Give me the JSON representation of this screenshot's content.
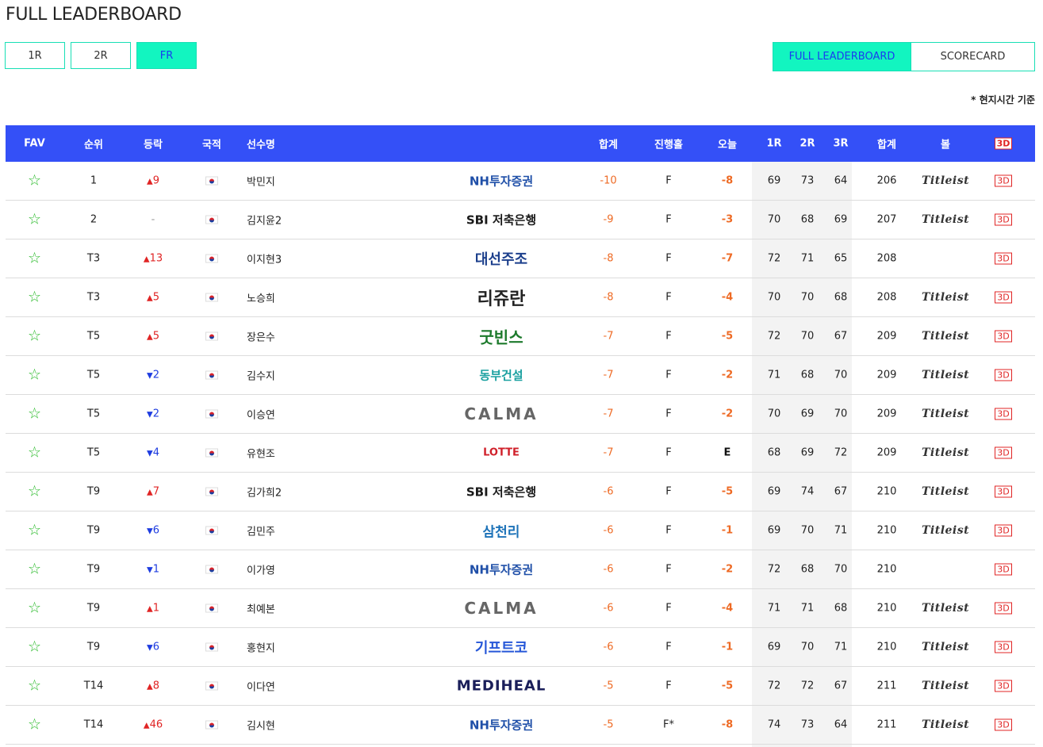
{
  "page_title": "FULL LEADERBOARD",
  "round_tabs": [
    {
      "label": "1R",
      "active": false
    },
    {
      "label": "2R",
      "active": false
    },
    {
      "label": "FR",
      "active": true
    }
  ],
  "view_tabs": [
    {
      "label": "FULL LEADERBOARD",
      "active": true
    },
    {
      "label": "SCORECARD",
      "active": false
    }
  ],
  "note": "* 현지시간 기준",
  "columns": {
    "fav": "FAV",
    "rank": "순위",
    "move": "등락",
    "nat": "국적",
    "name": "선수명",
    "total": "합계",
    "hole": "진행홀",
    "today": "오늘",
    "r1": "1R",
    "r2": "2R",
    "r3": "3R",
    "sum": "합계",
    "ball": "볼",
    "three_d": "3D"
  },
  "colors": {
    "header_bg": "#3450f7",
    "accent": "#12f5c0",
    "up": "#e02424",
    "down": "#1e3ce0",
    "score": "#ee6a24"
  },
  "rows": [
    {
      "rank": "1",
      "dir": "up",
      "move": "9",
      "name": "박민지",
      "sponsor": "NH투자증권",
      "total": "-10",
      "hole": "F",
      "today": "-8",
      "r1": "69",
      "r2": "73",
      "r3": "64",
      "sum": "206",
      "ball": "Titleist",
      "three_d": "3D"
    },
    {
      "rank": "2",
      "dir": "none",
      "move": "-",
      "name": "김지윤2",
      "sponsor": "SBI 저축은행",
      "total": "-9",
      "hole": "F",
      "today": "-3",
      "r1": "70",
      "r2": "68",
      "r3": "69",
      "sum": "207",
      "ball": "Titleist",
      "three_d": "3D"
    },
    {
      "rank": "T3",
      "dir": "up",
      "move": "13",
      "name": "이지현3",
      "sponsor": "대선주조",
      "total": "-8",
      "hole": "F",
      "today": "-7",
      "r1": "72",
      "r2": "71",
      "r3": "65",
      "sum": "208",
      "ball": "",
      "three_d": "3D"
    },
    {
      "rank": "T3",
      "dir": "up",
      "move": "5",
      "name": "노승희",
      "sponsor": "리쥬란",
      "total": "-8",
      "hole": "F",
      "today": "-4",
      "r1": "70",
      "r2": "70",
      "r3": "68",
      "sum": "208",
      "ball": "Titleist",
      "three_d": "3D"
    },
    {
      "rank": "T5",
      "dir": "up",
      "move": "5",
      "name": "장은수",
      "sponsor": "굿빈스",
      "total": "-7",
      "hole": "F",
      "today": "-5",
      "r1": "72",
      "r2": "70",
      "r3": "67",
      "sum": "209",
      "ball": "Titleist",
      "three_d": "3D"
    },
    {
      "rank": "T5",
      "dir": "down",
      "move": "2",
      "name": "김수지",
      "sponsor": "동부건설",
      "total": "-7",
      "hole": "F",
      "today": "-2",
      "r1": "71",
      "r2": "68",
      "r3": "70",
      "sum": "209",
      "ball": "Titleist",
      "three_d": "3D"
    },
    {
      "rank": "T5",
      "dir": "down",
      "move": "2",
      "name": "이승연",
      "sponsor": "CALMA",
      "total": "-7",
      "hole": "F",
      "today": "-2",
      "r1": "70",
      "r2": "69",
      "r3": "70",
      "sum": "209",
      "ball": "Titleist",
      "three_d": "3D"
    },
    {
      "rank": "T5",
      "dir": "down",
      "move": "4",
      "name": "유현조",
      "sponsor": "LOTTE",
      "total": "-7",
      "hole": "F",
      "today": "E",
      "r1": "68",
      "r2": "69",
      "r3": "72",
      "sum": "209",
      "ball": "Titleist",
      "three_d": "3D"
    },
    {
      "rank": "T9",
      "dir": "up",
      "move": "7",
      "name": "김가희2",
      "sponsor": "SBI 저축은행",
      "total": "-6",
      "hole": "F",
      "today": "-5",
      "r1": "69",
      "r2": "74",
      "r3": "67",
      "sum": "210",
      "ball": "Titleist",
      "three_d": "3D"
    },
    {
      "rank": "T9",
      "dir": "down",
      "move": "6",
      "name": "김민주",
      "sponsor": "삼천리",
      "total": "-6",
      "hole": "F",
      "today": "-1",
      "r1": "69",
      "r2": "70",
      "r3": "71",
      "sum": "210",
      "ball": "Titleist",
      "three_d": "3D"
    },
    {
      "rank": "T9",
      "dir": "down",
      "move": "1",
      "name": "이가영",
      "sponsor": "NH투자증권",
      "total": "-6",
      "hole": "F",
      "today": "-2",
      "r1": "72",
      "r2": "68",
      "r3": "70",
      "sum": "210",
      "ball": "",
      "three_d": "3D"
    },
    {
      "rank": "T9",
      "dir": "up",
      "move": "1",
      "name": "최예본",
      "sponsor": "CALMA",
      "total": "-6",
      "hole": "F",
      "today": "-4",
      "r1": "71",
      "r2": "71",
      "r3": "68",
      "sum": "210",
      "ball": "Titleist",
      "three_d": "3D"
    },
    {
      "rank": "T9",
      "dir": "down",
      "move": "6",
      "name": "홍현지",
      "sponsor": "기프트코",
      "total": "-6",
      "hole": "F",
      "today": "-1",
      "r1": "69",
      "r2": "70",
      "r3": "71",
      "sum": "210",
      "ball": "Titleist",
      "three_d": "3D"
    },
    {
      "rank": "T14",
      "dir": "up",
      "move": "8",
      "name": "이다연",
      "sponsor": "MEDIHEAL",
      "total": "-5",
      "hole": "F",
      "today": "-5",
      "r1": "72",
      "r2": "72",
      "r3": "67",
      "sum": "211",
      "ball": "Titleist",
      "three_d": "3D"
    },
    {
      "rank": "T14",
      "dir": "up",
      "move": "46",
      "name": "김시현",
      "sponsor": "NH투자증권",
      "total": "-5",
      "hole": "F*",
      "today": "-8",
      "r1": "74",
      "r2": "73",
      "r3": "64",
      "sum": "211",
      "ball": "Titleist",
      "three_d": "3D"
    }
  ]
}
